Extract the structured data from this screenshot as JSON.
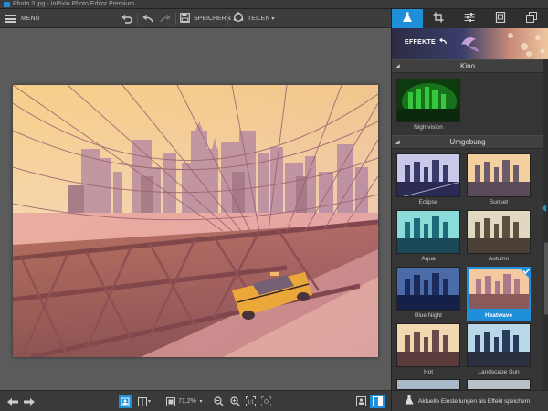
{
  "window": {
    "title": "Photo 3.jpg - InPixio Photo Editor Premium"
  },
  "toolbar": {
    "menu_label": "MENÜ",
    "save_label": "SPEICHERN",
    "share_label": "TEILEN",
    "icons": [
      "hamburger-icon",
      "rotate-icon",
      "undo-icon",
      "redo-icon",
      "save-icon",
      "share-icon"
    ]
  },
  "panel": {
    "tabs": [
      {
        "name": "effects",
        "icon": "flask-icon",
        "active": true
      },
      {
        "name": "crop",
        "icon": "crop-icon",
        "active": false
      },
      {
        "name": "adjust",
        "icon": "sliders-icon",
        "active": false
      },
      {
        "name": "frame",
        "icon": "frame-icon",
        "active": false
      },
      {
        "name": "layers",
        "icon": "layers-icon",
        "active": false
      }
    ],
    "banner_label": "EFFEKTE",
    "sections": [
      {
        "title": "Kino",
        "items": [
          {
            "label": "Nightvision"
          }
        ]
      },
      {
        "title": "Umgebung",
        "items": [
          {
            "label": "Eclipse"
          },
          {
            "label": "Sunset"
          },
          {
            "label": "Aqua"
          },
          {
            "label": "Autumn"
          },
          {
            "label": "Blue Night"
          },
          {
            "label": "Heatwave",
            "selected": true
          },
          {
            "label": "Hot"
          },
          {
            "label": "Landscape Sun"
          }
        ]
      }
    ],
    "save_preset_label": "Aktuelle Einstellungen als Effekt speichern"
  },
  "bottombar": {
    "zoom": "71,2%"
  },
  "colors": {
    "accent": "#1e8fd8",
    "panel_bg": "#353535",
    "canvas_bg": "#5b5b5b"
  }
}
